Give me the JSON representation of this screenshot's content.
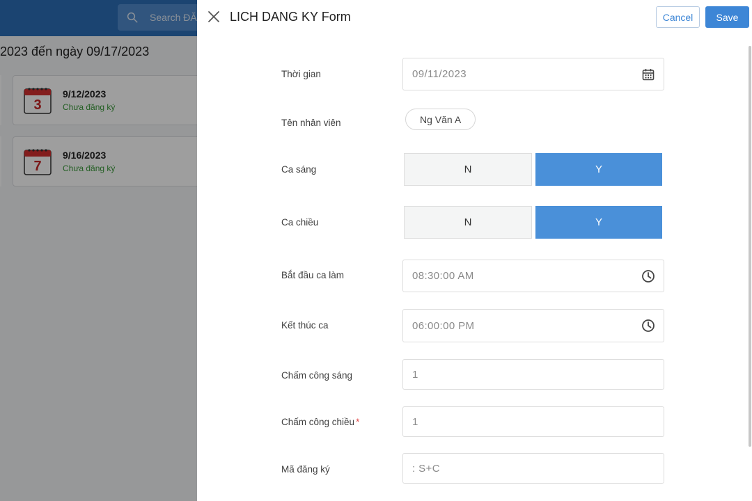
{
  "background": {
    "search_placeholder": "Search ĐĂ",
    "date_range": "2023 đến ngày 09/17/2023",
    "cards": [
      {
        "day_number": "3",
        "date": "9/12/2023",
        "status": "Chưa đăng ký"
      },
      {
        "day_number": "7",
        "date": "9/16/2023",
        "status": "Chưa đăng ký"
      }
    ]
  },
  "drawer": {
    "title": "LICH DANG KY Form",
    "cancel_label": "Cancel",
    "save_label": "Save"
  },
  "form": {
    "thoi_gian": {
      "label": "Thời gian",
      "value": "09/11/2023"
    },
    "ten_nhan_vien": {
      "label": "Tên nhân viên",
      "value": "Ng Văn A"
    },
    "ca_sang": {
      "label": "Ca sáng",
      "option_n": "N",
      "option_y": "Y",
      "selected": "Y"
    },
    "ca_chieu": {
      "label": "Ca chiều",
      "option_n": "N",
      "option_y": "Y",
      "selected": "Y"
    },
    "bat_dau_ca_lam": {
      "label": "Bắt đầu ca làm",
      "value": "08:30:00  AM"
    },
    "ket_thuc_ca": {
      "label": "Kết thúc ca",
      "value": "06:00:00  PM"
    },
    "cham_cong_sang": {
      "label": "Chấm công sáng",
      "value": "1"
    },
    "cham_cong_chieu": {
      "label": "Chấm công chiều",
      "required_mark": "*",
      "value": "1"
    },
    "ma_dang_ky": {
      "label": "Mã đăng ký",
      "value": ": S+C"
    }
  },
  "colors": {
    "primary": "#3d86d6",
    "toggle_selected": "#4a90d9",
    "status_green": "#3a9a3a",
    "topbar": "#2d6fb7"
  }
}
